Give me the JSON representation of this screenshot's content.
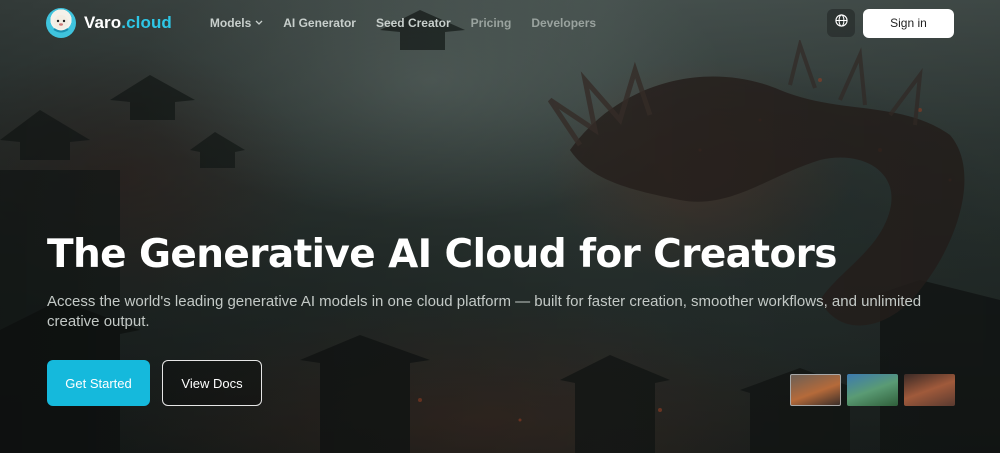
{
  "brand": {
    "name": "Varo",
    "tld": ".cloud",
    "logo_icon": "mascot-icon"
  },
  "nav": {
    "items": [
      {
        "label": "Models",
        "has_dropdown": true
      },
      {
        "label": "AI Generator",
        "has_dropdown": false
      },
      {
        "label": "Seed Creator",
        "has_dropdown": false
      },
      {
        "label": "Pricing",
        "has_dropdown": false
      },
      {
        "label": "Developers",
        "has_dropdown": false
      }
    ],
    "language_icon": "globe-icon",
    "sign_in_label": "Sign in"
  },
  "hero": {
    "headline": "The Generative AI Cloud for Creators",
    "subtitle": "Access the world's leading generative AI models in one cloud platform — built for faster creation, smoother workflows, and unlimited creative output.",
    "primary_cta": "Get Started",
    "secondary_cta": "View Docs",
    "thumbnails": [
      "fire-scene-thumbnail",
      "landscape-thumbnail",
      "warm-scene-thumbnail"
    ],
    "selected_thumbnail": 0
  },
  "colors": {
    "accent": "#15b9dc",
    "brand_tld": "#2ec7e6",
    "background": "#2a3431"
  }
}
